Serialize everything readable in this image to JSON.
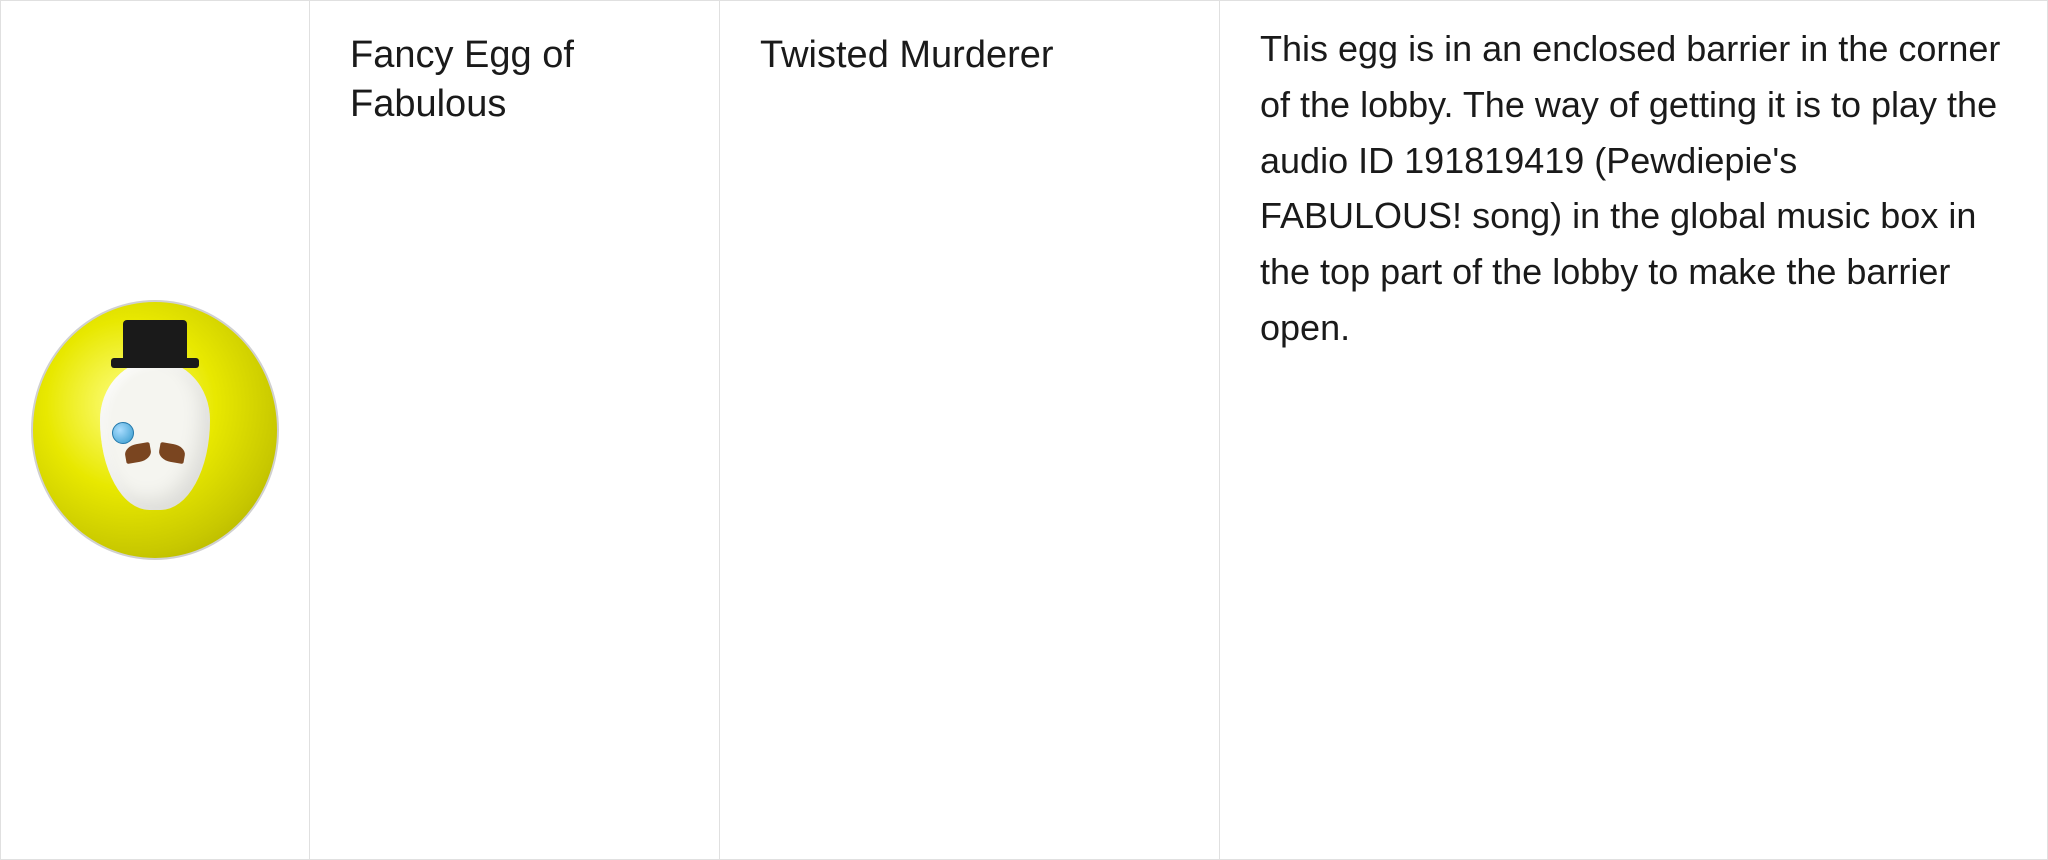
{
  "row": {
    "egg_name": "Fancy Egg of Fabulous",
    "game_name": "Twisted Murderer",
    "description": "This egg is in an enclosed barrier in the corner of the lobby. The way of getting it is to play the audio ID 191819419 (Pewdiepie's FABULOUS! song) in the global music box in the top part of the lobby to make the barrier open.",
    "image_alt": "Fancy Egg of Fabulous"
  }
}
